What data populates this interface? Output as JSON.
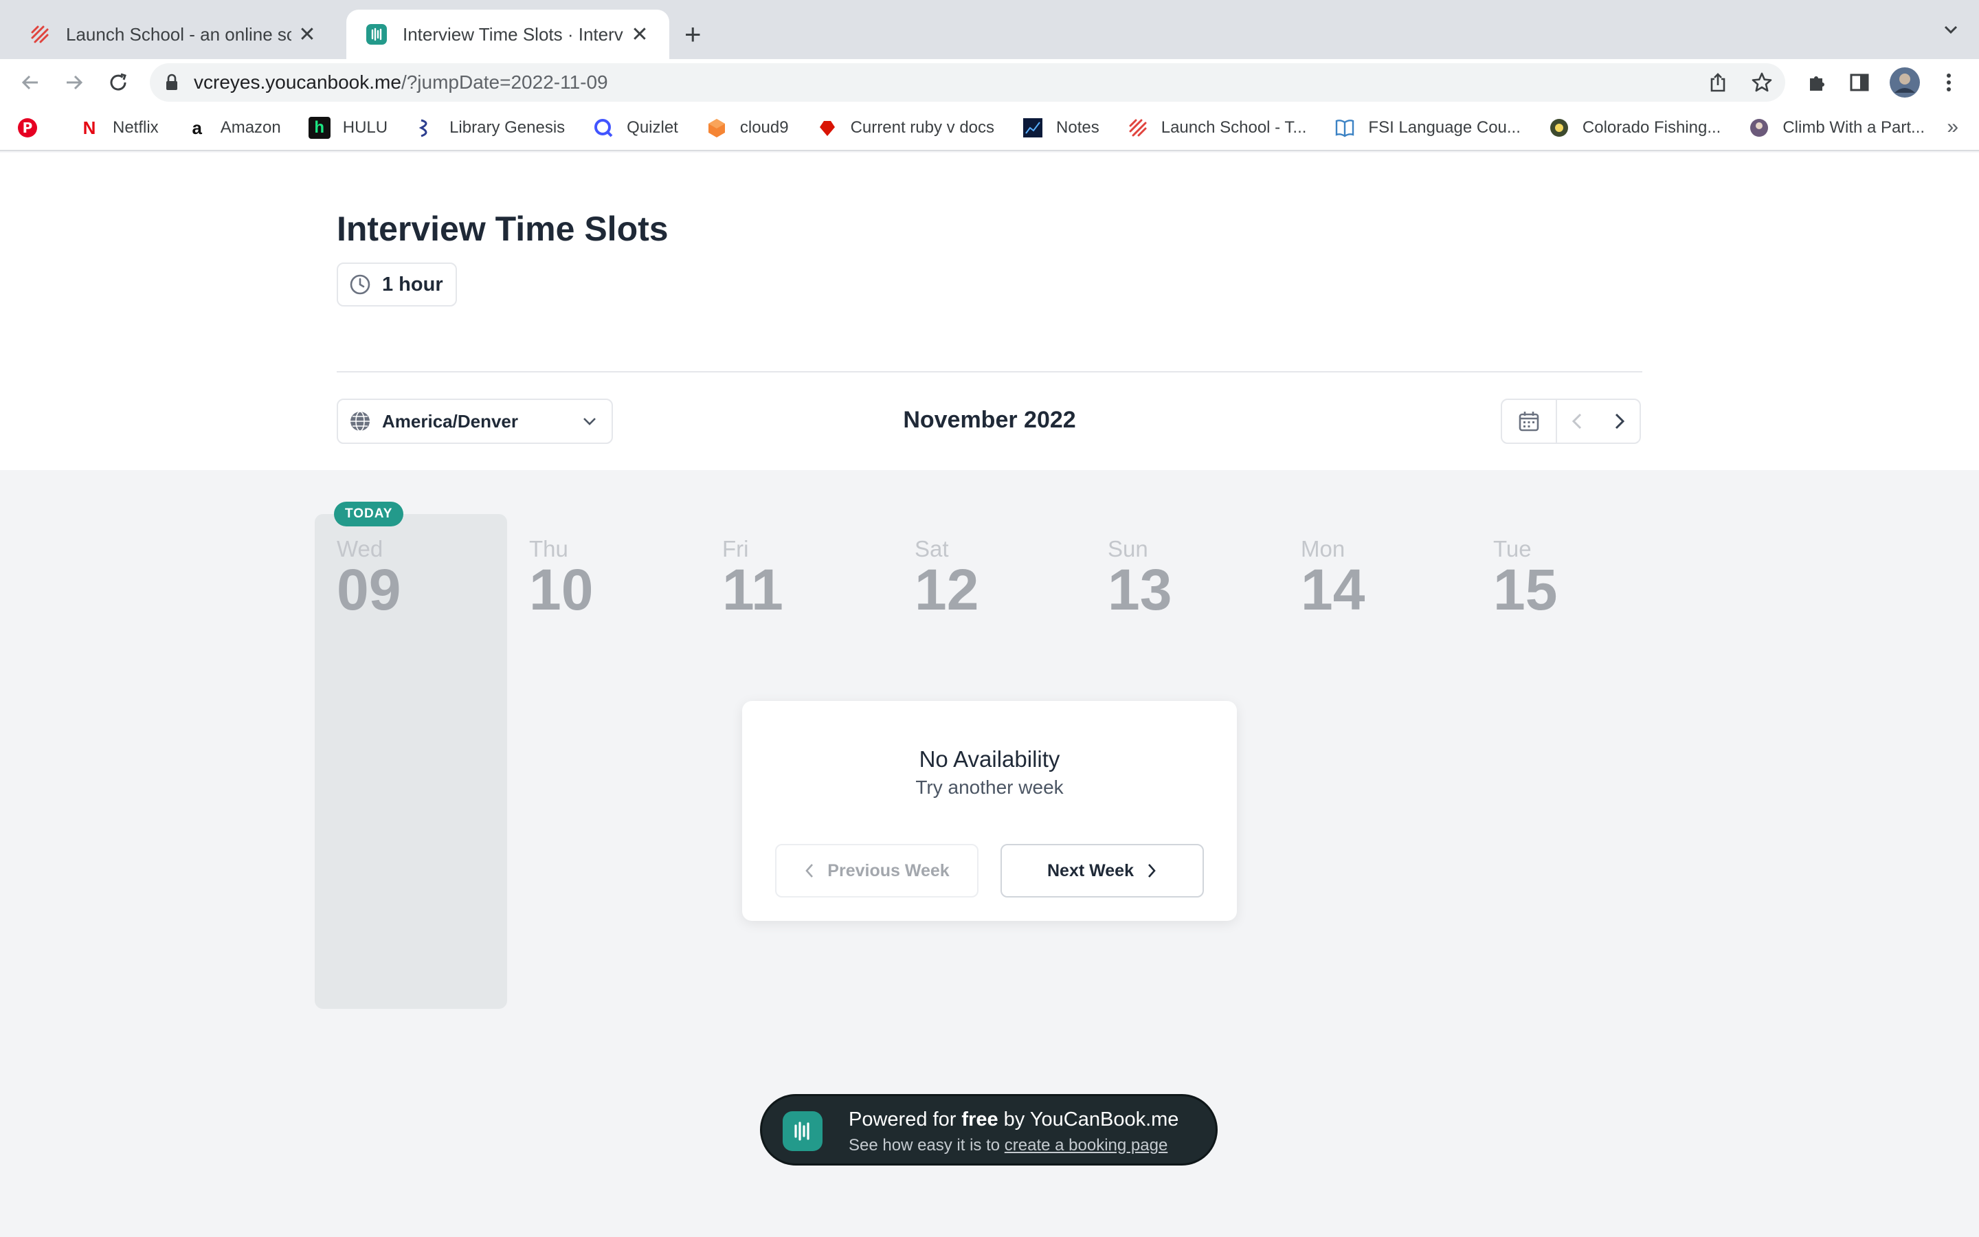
{
  "browser": {
    "tabs": [
      {
        "title": "Launch School - an online school",
        "active": false
      },
      {
        "title": "Interview Time Slots · Interview",
        "active": true
      }
    ],
    "url_host": "vcreyes.youcanbook.me",
    "url_path": "/?jumpDate=2022-11-09",
    "bookmarks": [
      {
        "label": "",
        "icon": "pinterest-icon"
      },
      {
        "label": "Netflix",
        "icon": "netflix-icon"
      },
      {
        "label": "Amazon",
        "icon": "amazon-icon"
      },
      {
        "label": "HULU",
        "icon": "hulu-icon"
      },
      {
        "label": "Library Genesis",
        "icon": "library-genesis-icon"
      },
      {
        "label": "Quizlet",
        "icon": "quizlet-icon"
      },
      {
        "label": "cloud9",
        "icon": "cloud9-icon"
      },
      {
        "label": "Current ruby v docs",
        "icon": "ruby-icon"
      },
      {
        "label": "Notes",
        "icon": "notes-icon"
      },
      {
        "label": "Launch School - T...",
        "icon": "launch-school-icon"
      },
      {
        "label": "FSI Language Cou...",
        "icon": "book-icon"
      },
      {
        "label": "Colorado Fishing...",
        "icon": "colorado-icon"
      },
      {
        "label": "Climb With a Part...",
        "icon": "climb-icon"
      }
    ]
  },
  "page": {
    "title": "Interview Time Slots",
    "duration": "1 hour",
    "timezone": "America/Denver",
    "month": "November 2022",
    "today_badge": "TODAY",
    "days": [
      {
        "name": "Wed",
        "date": "09",
        "today": true
      },
      {
        "name": "Thu",
        "date": "10"
      },
      {
        "name": "Fri",
        "date": "11"
      },
      {
        "name": "Sat",
        "date": "12"
      },
      {
        "name": "Sun",
        "date": "13"
      },
      {
        "name": "Mon",
        "date": "14"
      },
      {
        "name": "Tue",
        "date": "15"
      }
    ],
    "empty": {
      "heading": "No Availability",
      "sub": "Try another week",
      "prev_label": "Previous Week",
      "next_label": "Next Week"
    },
    "footer": {
      "line1_pre": "Powered for ",
      "line1_bold": "free",
      "line1_post": " by YouCanBook.me",
      "line2_pre": "See how easy it is to ",
      "line2_link": "create a booking page"
    }
  },
  "colors": {
    "accent": "#239a8b",
    "today_column": "#e4e7e9",
    "page_bg": "#f3f4f6"
  }
}
